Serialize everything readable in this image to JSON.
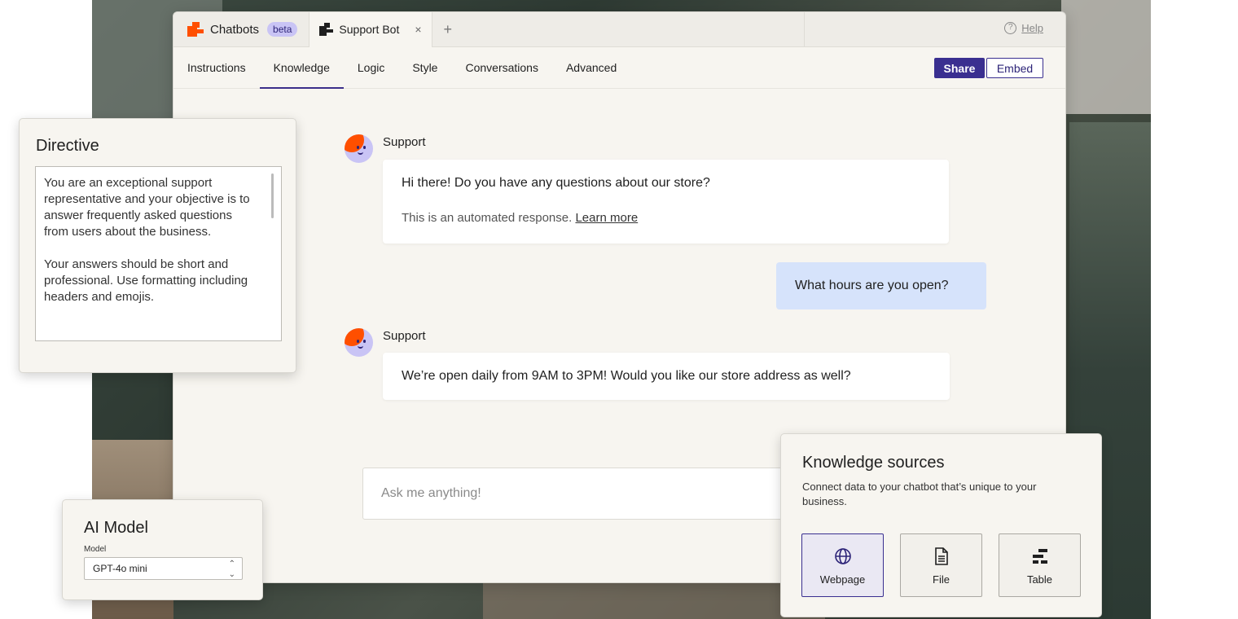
{
  "header": {
    "app_title": "Chatbots",
    "beta_badge": "beta",
    "tab_title": "Support Bot",
    "close_glyph": "×",
    "add_glyph": "+",
    "help_label": "Help"
  },
  "nav": {
    "items": [
      {
        "label": "Instructions"
      },
      {
        "label": "Knowledge"
      },
      {
        "label": "Logic"
      },
      {
        "label": "Style"
      },
      {
        "label": "Conversations"
      },
      {
        "label": "Advanced"
      }
    ],
    "active": "Knowledge",
    "share_label": "Share",
    "embed_label": "Embed"
  },
  "chat": {
    "messages": [
      {
        "sender": "Support",
        "text": "Hi there! Do you have any questions about our store?",
        "note": "This is an automated response.",
        "note_link": "Learn more"
      },
      {
        "sender": "user",
        "text": "What hours are you open?"
      },
      {
        "sender": "Support",
        "text": "We’re open daily from 9AM to 3PM! Would you like our store address as well?"
      }
    ],
    "input_placeholder": "Ask me anything!"
  },
  "directive": {
    "title": "Directive",
    "paragraphs": [
      "You are an exceptional support representative and your objective is to answer frequently asked questions from users about the business.",
      "Your answers should be short and professional. Use formatting including headers and emojis."
    ]
  },
  "ai_model": {
    "title": "AI Model",
    "field_label": "Model",
    "selected_value": "GPT-4o mini"
  },
  "knowledge_sources": {
    "title": "Knowledge sources",
    "description": "Connect data to your chatbot that’s unique to your business.",
    "options": [
      {
        "label": "Webpage",
        "icon": "globe-icon",
        "selected": true
      },
      {
        "label": "File",
        "icon": "file-icon",
        "selected": false
      },
      {
        "label": "Table",
        "icon": "table-icon",
        "selected": false
      }
    ]
  },
  "colors": {
    "accent": "#3a2f90",
    "brand_orange": "#ff4f00",
    "user_bubble": "#d6e3fb",
    "avatar_bg": "#c9c4f5"
  }
}
